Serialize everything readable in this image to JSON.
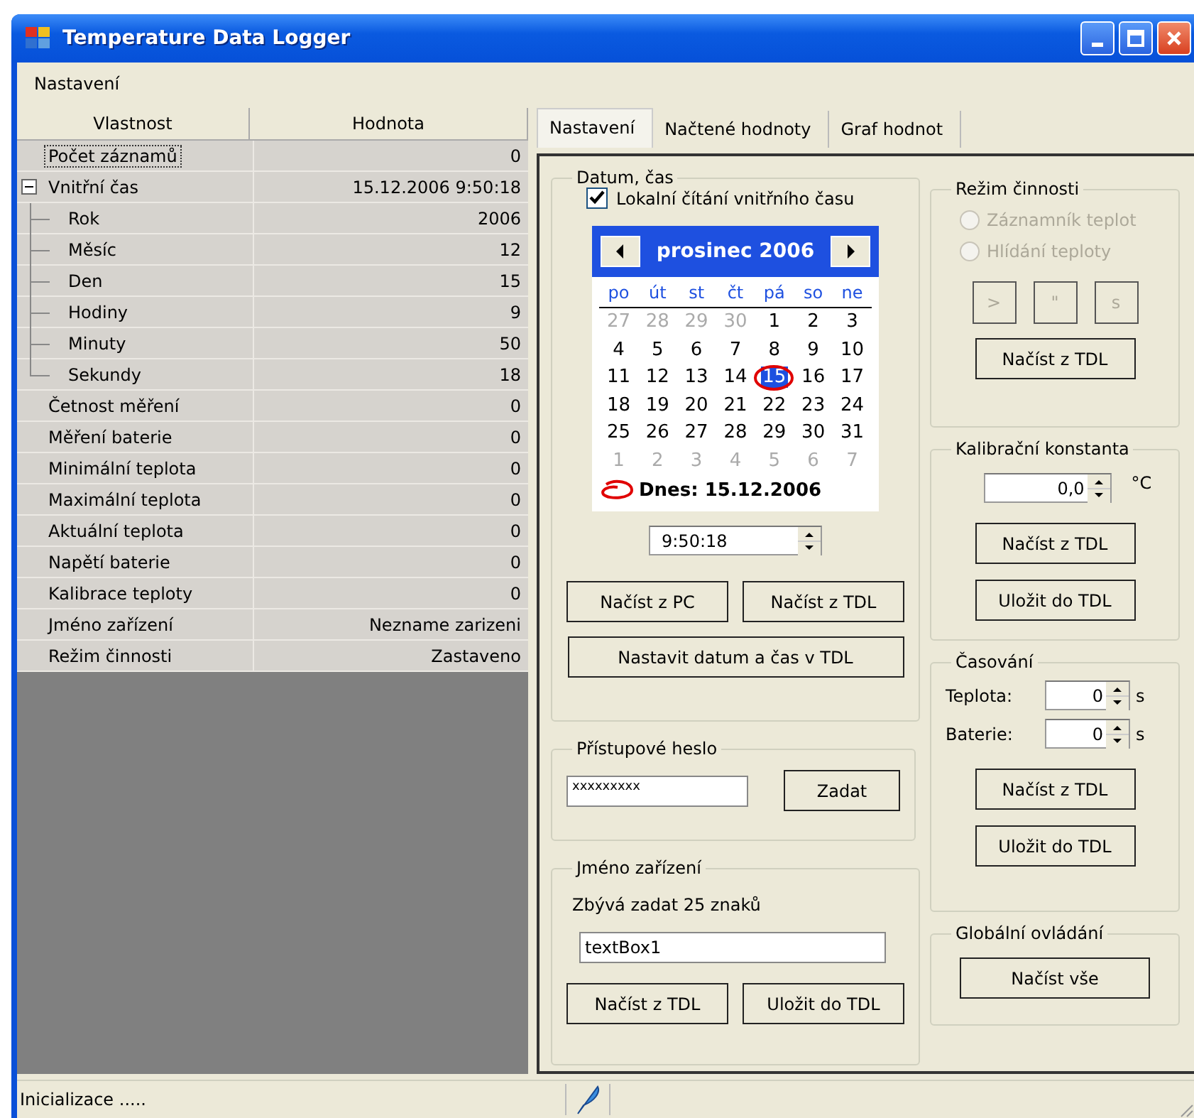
{
  "window": {
    "title": "Temperature Data Logger"
  },
  "menu": [
    {
      "label": "Nastavení"
    }
  ],
  "property_grid": {
    "columns": [
      "Vlastnost",
      "Hodnota"
    ],
    "rows": [
      {
        "name": "Počet záznamů",
        "value": "0",
        "selected": true
      },
      {
        "name": "Vnitřní čas",
        "value": "15.12.2006 9:50:18",
        "selected": false,
        "expanded": true,
        "children": [
          {
            "name": "Rok",
            "value": "2006",
            "selected": false
          },
          {
            "name": "Měsíc",
            "value": "12",
            "selected": false
          },
          {
            "name": "Den",
            "value": "15",
            "selected": false
          },
          {
            "name": "Hodiny",
            "value": "9",
            "selected": false
          },
          {
            "name": "Minuty",
            "value": "50",
            "selected": false
          },
          {
            "name": "Sekundy",
            "value": "18",
            "selected": false
          }
        ]
      },
      {
        "name": "Četnost měření",
        "value": "0",
        "selected": false
      },
      {
        "name": "Měření baterie",
        "value": "0",
        "selected": false
      },
      {
        "name": "Minimální teplota",
        "value": "0",
        "selected": false
      },
      {
        "name": "Maximální teplota",
        "value": "0",
        "selected": false
      },
      {
        "name": "Aktuální teplota",
        "value": "0",
        "selected": false
      },
      {
        "name": "Napětí baterie",
        "value": "0",
        "selected": false
      },
      {
        "name": "Kalibrace teploty",
        "value": "0",
        "selected": false
      },
      {
        "name": "Jméno zařízení",
        "value": "Nezname zarizeni",
        "selected": false
      },
      {
        "name": "Režim činnosti",
        "value": "Zastaveno",
        "selected": false
      }
    ]
  },
  "tabs": [
    {
      "label": "Nastavení",
      "selected": true
    },
    {
      "label": "Načtené hodnoty",
      "selected": false
    },
    {
      "label": "Graf hodnot",
      "selected": false
    }
  ],
  "datum_cas": {
    "title": "Datum, čas",
    "checkbox": {
      "label": "Lokalní čítání vnitřního času",
      "checked": true
    },
    "calendar": {
      "month": "prosinec 2006",
      "weekdays": [
        "po",
        "út",
        "st",
        "čt",
        "pá",
        "so",
        "ne"
      ],
      "days": [
        {
          "label": "27",
          "other_month": true,
          "selected": false
        },
        {
          "label": "28",
          "other_month": true,
          "selected": false
        },
        {
          "label": "29",
          "other_month": true,
          "selected": false
        },
        {
          "label": "30",
          "other_month": true,
          "selected": false
        },
        {
          "label": "1",
          "other_month": false,
          "selected": false
        },
        {
          "label": "2",
          "other_month": false,
          "selected": false
        },
        {
          "label": "3",
          "other_month": false,
          "selected": false
        },
        {
          "label": "4",
          "other_month": false,
          "selected": false
        },
        {
          "label": "5",
          "other_month": false,
          "selected": false
        },
        {
          "label": "6",
          "other_month": false,
          "selected": false
        },
        {
          "label": "7",
          "other_month": false,
          "selected": false
        },
        {
          "label": "8",
          "other_month": false,
          "selected": false
        },
        {
          "label": "9",
          "other_month": false,
          "selected": false
        },
        {
          "label": "10",
          "other_month": false,
          "selected": false
        },
        {
          "label": "11",
          "other_month": false,
          "selected": false
        },
        {
          "label": "12",
          "other_month": false,
          "selected": false
        },
        {
          "label": "13",
          "other_month": false,
          "selected": false
        },
        {
          "label": "14",
          "other_month": false,
          "selected": false
        },
        {
          "label": "15",
          "other_month": false,
          "selected": true
        },
        {
          "label": "16",
          "other_month": false,
          "selected": false
        },
        {
          "label": "17",
          "other_month": false,
          "selected": false
        },
        {
          "label": "18",
          "other_month": false,
          "selected": false
        },
        {
          "label": "19",
          "other_month": false,
          "selected": false
        },
        {
          "label": "20",
          "other_month": false,
          "selected": false
        },
        {
          "label": "21",
          "other_month": false,
          "selected": false
        },
        {
          "label": "22",
          "other_month": false,
          "selected": false
        },
        {
          "label": "23",
          "other_month": false,
          "selected": false
        },
        {
          "label": "24",
          "other_month": false,
          "selected": false
        },
        {
          "label": "25",
          "other_month": false,
          "selected": false
        },
        {
          "label": "26",
          "other_month": false,
          "selected": false
        },
        {
          "label": "27",
          "other_month": false,
          "selected": false
        },
        {
          "label": "28",
          "other_month": false,
          "selected": false
        },
        {
          "label": "29",
          "other_month": false,
          "selected": false
        },
        {
          "label": "30",
          "other_month": false,
          "selected": false
        },
        {
          "label": "31",
          "other_month": false,
          "selected": false
        },
        {
          "label": "1",
          "other_month": true,
          "selected": false
        },
        {
          "label": "2",
          "other_month": true,
          "selected": false
        },
        {
          "label": "3",
          "other_month": true,
          "selected": false
        },
        {
          "label": "4",
          "other_month": true,
          "selected": false
        },
        {
          "label": "5",
          "other_month": true,
          "selected": false
        },
        {
          "label": "6",
          "other_month": true,
          "selected": false
        },
        {
          "label": "7",
          "other_month": true,
          "selected": false
        }
      ],
      "today": "Dnes: 15.12.2006"
    },
    "time": "9:50:18",
    "buttons": [
      "Načíst z PC",
      "Načíst z TDL"
    ],
    "wide_button": "Nastavit datum a čas v TDL"
  },
  "pristupove_heslo": {
    "title": "Přístupové heslo",
    "value": "xxxxxxxxx",
    "button": "Zadat"
  },
  "jmeno_zarizeni": {
    "title": "Jméno zařízení",
    "remaining": "Zbývá zadat 25 znaků",
    "value": "textBox1",
    "buttons": [
      "Načíst z TDL",
      "Uložit do TDL"
    ]
  },
  "rezim_cinnosti": {
    "title": "Režim činnosti",
    "options": [
      {
        "label": "Záznamník teplot",
        "selected": false,
        "disabled": true
      },
      {
        "label": "Hlídání teploty",
        "selected": false,
        "disabled": true
      }
    ],
    "small_buttons": [
      {
        "label": ">",
        "disabled": true
      },
      {
        "label": "\"",
        "disabled": true
      },
      {
        "label": "s",
        "disabled": true
      }
    ],
    "button": "Načíst z TDL"
  },
  "kalibracni_konstanta": {
    "title": "Kalibrační konstanta",
    "value": "0,0",
    "unit": "°C",
    "buttons": [
      "Načíst z TDL",
      "Uložit do TDL"
    ]
  },
  "casovani": {
    "title": "Časování",
    "fields": [
      {
        "label": "Teplota:",
        "value": "0",
        "unit": "s"
      },
      {
        "label": "Baterie:",
        "value": "0",
        "unit": "s"
      }
    ],
    "buttons": [
      "Načíst z TDL",
      "Uložit do TDL"
    ]
  },
  "globalni_ovladani": {
    "title": "Globální ovládání",
    "button": "Načíst vše"
  },
  "status_bar": {
    "text": "Inicializace ....."
  }
}
